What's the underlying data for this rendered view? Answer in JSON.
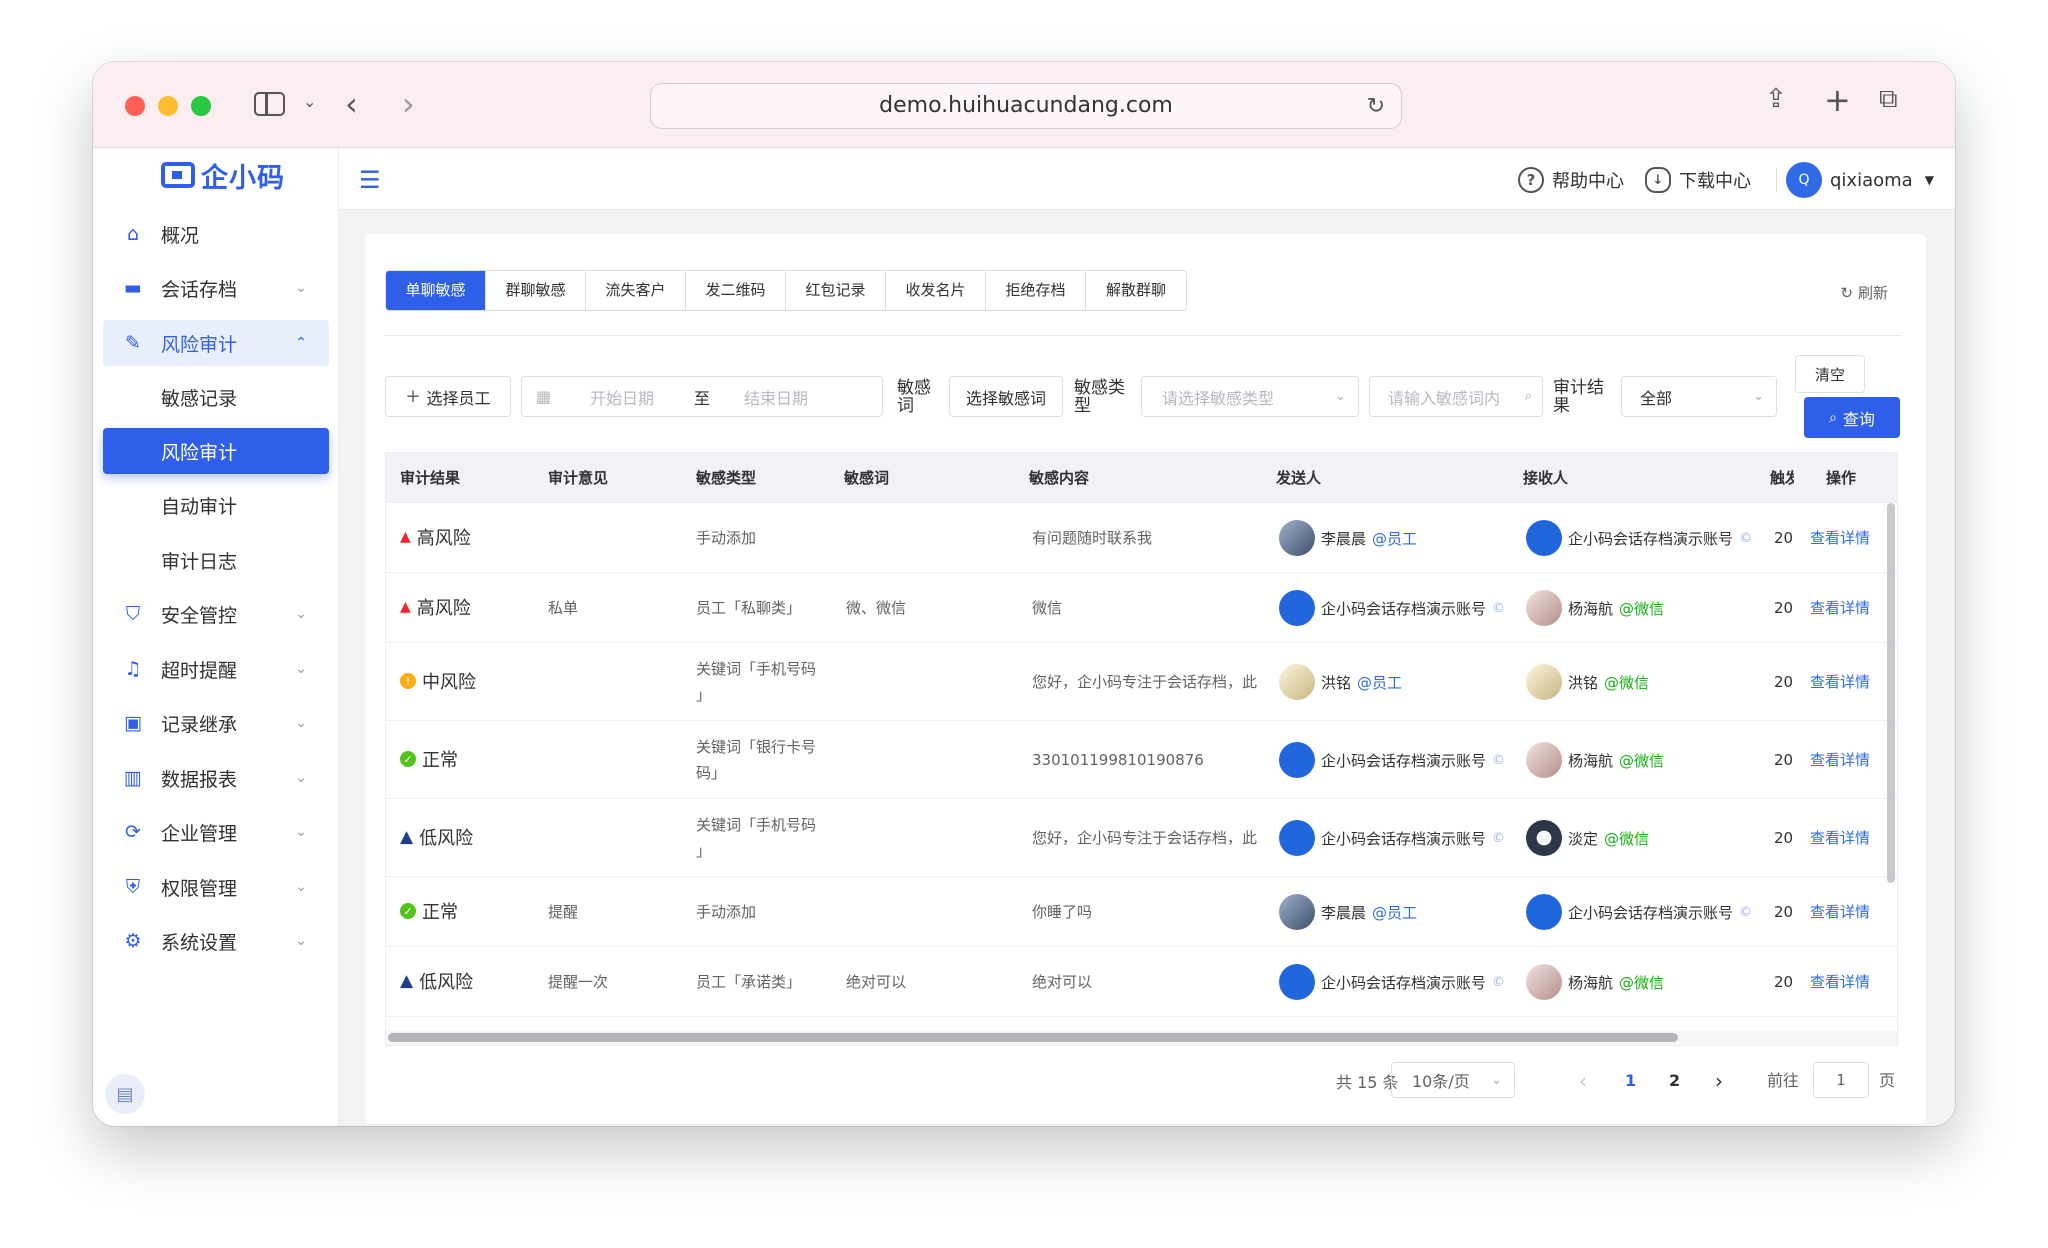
{
  "browser": {
    "url": "demo.huihuacundang.com"
  },
  "app": {
    "logo_text": "企小码"
  },
  "sidebar": {
    "items": [
      {
        "label": "概况",
        "icon": "home-icon"
      },
      {
        "label": "会话存档",
        "icon": "folder-icon"
      },
      {
        "label": "风险审计",
        "icon": "edit-icon"
      },
      {
        "label": "安全管控",
        "icon": "shield-icon"
      },
      {
        "label": "超时提醒",
        "icon": "bell-icon"
      },
      {
        "label": "记录继承",
        "icon": "id-card-icon"
      },
      {
        "label": "数据报表",
        "icon": "bar-chart-icon"
      },
      {
        "label": "企业管理",
        "icon": "sync-icon"
      },
      {
        "label": "权限管理",
        "icon": "lock-shield-icon"
      },
      {
        "label": "系统设置",
        "icon": "gear-icon"
      }
    ],
    "sub_items": [
      "敏感记录",
      "风险审计",
      "自动审计",
      "审计日志"
    ]
  },
  "topbar": {
    "help": "帮助中心",
    "download": "下载中心",
    "user": "qixiaoma",
    "avatar_letter": "Q"
  },
  "tabs": [
    "单聊敏感",
    "群聊敏感",
    "流失客户",
    "发二维码",
    "红包记录",
    "收发名片",
    "拒绝存档",
    "解散群聊"
  ],
  "refresh_label": "刷新",
  "filters": {
    "select_employee": "选择员工",
    "start_date": "开始日期",
    "range_sep": "至",
    "end_date": "结束日期",
    "sensitive_word_label_1": "敏感",
    "sensitive_word_label_2": "词",
    "select_sensitive_word": "选择敏感词",
    "sensitive_type_label_1": "敏感类",
    "sensitive_type_label_2": "型",
    "sensitive_type_placeholder": "请选择敏感类型",
    "sensitive_word_input_placeholder": "请输入敏感词内",
    "audit_result_label_1": "审计结",
    "audit_result_label_2": "果",
    "audit_result_value": "全部",
    "clear": "清空",
    "query": "查询"
  },
  "table": {
    "headers": [
      "审计结果",
      "审计意见",
      "敏感类型",
      "敏感词",
      "敏感内容",
      "发送人",
      "接收人",
      "触发",
      "操作"
    ],
    "rows": [
      {
        "result": "高风险",
        "level": "high",
        "opinion": "",
        "type_1": "手动添加",
        "type_2": "",
        "word": "",
        "content": "有问题随时联系我",
        "sender": "李晨晨",
        "sender_tag": "@员工",
        "sender_av": "photo",
        "receiver": "企小码会话存档演示账号",
        "receiver_tag": "©",
        "receiver_av": "code",
        "trigger": "20",
        "action": "查看详情"
      },
      {
        "result": "高风险",
        "level": "high",
        "opinion": "私单",
        "type_1": "员工「私聊类」",
        "type_2": "",
        "word": "微、微信",
        "content": "微信",
        "sender": "企小码会话存档演示账号",
        "sender_tag": "©",
        "sender_av": "code",
        "receiver": "杨海航",
        "receiver_tag": "@微信",
        "receiver_av": "girl",
        "trigger": "20",
        "action": "查看详情"
      },
      {
        "result": "中风险",
        "level": "mid",
        "opinion": "",
        "type_1": "关键词「手机号码",
        "type_2": "」",
        "word": "",
        "content": "您好，企小码专注于会话存档，此",
        "sender": "洪铭",
        "sender_tag": "@员工",
        "sender_av": "cartoon",
        "receiver": "洪铭",
        "receiver_tag": "@微信",
        "receiver_av": "cartoon",
        "trigger": "20",
        "action": "查看详情"
      },
      {
        "result": "正常",
        "level": "ok",
        "opinion": "",
        "type_1": "关键词「银行卡号",
        "type_2": "码」",
        "word": "",
        "content": "330101199810190876",
        "sender": "企小码会话存档演示账号",
        "sender_tag": "©",
        "sender_av": "code",
        "receiver": "杨海航",
        "receiver_tag": "@微信",
        "receiver_av": "girl",
        "trigger": "20",
        "action": "查看详情"
      },
      {
        "result": "低风险",
        "level": "low",
        "opinion": "",
        "type_1": "关键词「手机号码",
        "type_2": "」",
        "word": "",
        "content": "您好，企小码专注于会话存档，此",
        "sender": "企小码会话存档演示账号",
        "sender_tag": "©",
        "sender_av": "code",
        "receiver": "淡定",
        "receiver_tag": "@微信",
        "receiver_av": "dark",
        "trigger": "20",
        "action": "查看详情"
      },
      {
        "result": "正常",
        "level": "ok",
        "opinion": "提醒",
        "type_1": "手动添加",
        "type_2": "",
        "word": "",
        "content": "你睡了吗",
        "sender": "李晨晨",
        "sender_tag": "@员工",
        "sender_av": "photo",
        "receiver": "企小码会话存档演示账号",
        "receiver_tag": "©",
        "receiver_av": "code",
        "trigger": "20",
        "action": "查看详情"
      },
      {
        "result": "低风险",
        "level": "low",
        "opinion": "提醒一次",
        "type_1": "员工「承诺类」",
        "type_2": "",
        "word": "绝对可以",
        "content": "绝对可以",
        "sender": "企小码会话存档演示账号",
        "sender_tag": "©",
        "sender_av": "code",
        "receiver": "杨海航",
        "receiver_tag": "@微信",
        "receiver_av": "girl",
        "trigger": "20",
        "action": "查看详情"
      }
    ]
  },
  "pagination": {
    "total": "共 15 条",
    "page_size": "10条/页",
    "pages": [
      "1",
      "2"
    ],
    "current": "1",
    "goto_label": "前往",
    "goto_value": "1",
    "page_suffix": "页"
  },
  "colors": {
    "primary": "#2f5fe8",
    "high": "#f5222d",
    "mid": "#faad14",
    "ok": "#52c41a",
    "low": "#1f3d8a"
  }
}
